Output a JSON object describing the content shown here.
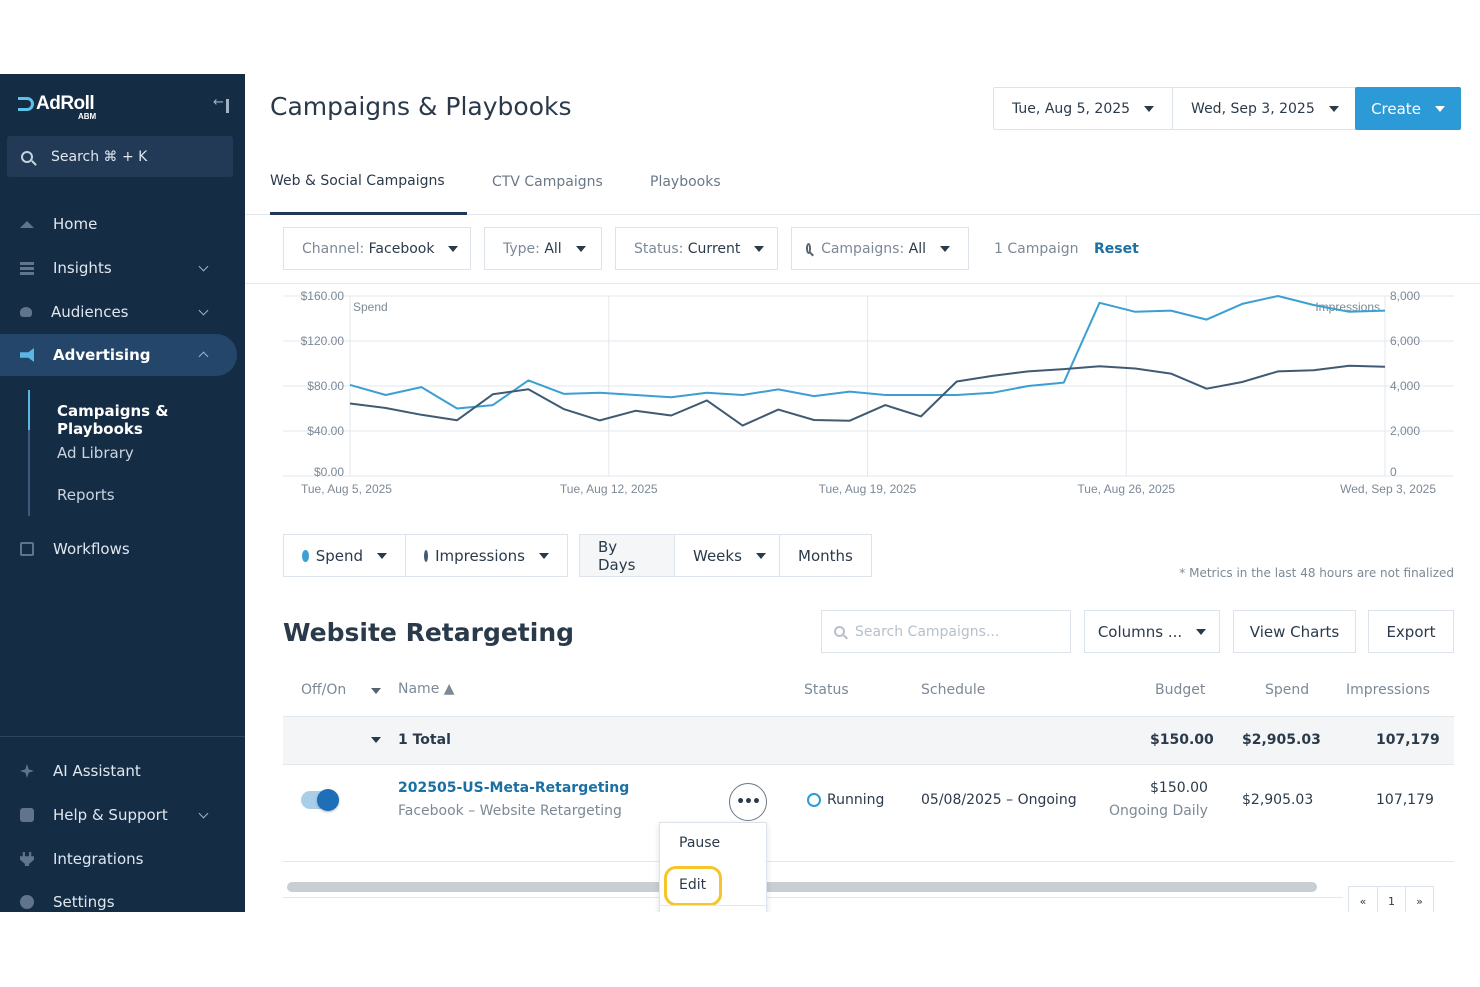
{
  "app": {
    "logo_text": "AdRoll",
    "logo_sub": "ABM"
  },
  "sidebar": {
    "search_label": "Search ⌘ + K",
    "items": [
      {
        "label": "Home",
        "icon": "home-icon"
      },
      {
        "label": "Insights",
        "icon": "bar-chart-icon"
      },
      {
        "label": "Audiences",
        "icon": "people-icon"
      },
      {
        "label": "Advertising",
        "icon": "megaphone-icon"
      },
      {
        "label": "Workflows",
        "icon": "workflow-icon"
      }
    ],
    "subitems": [
      "Campaigns & Playbooks",
      "Ad Library",
      "Reports"
    ],
    "bottom_items": [
      {
        "label": "AI Assistant",
        "icon": "sparkle-icon"
      },
      {
        "label": "Help & Support",
        "icon": "help-icon"
      },
      {
        "label": "Integrations",
        "icon": "plug-icon"
      },
      {
        "label": "Settings",
        "icon": "gear-icon"
      }
    ]
  },
  "header": {
    "title": "Campaigns & Playbooks",
    "start_date": "Tue, Aug 5, 2025",
    "end_date": "Wed, Sep 3, 2025",
    "create_label": "Create"
  },
  "tabs": [
    "Web & Social Campaigns",
    "CTV Campaigns",
    "Playbooks"
  ],
  "filters": {
    "channel_label": "Channel:",
    "channel_value": "Facebook",
    "type_label": "Type:",
    "type_value": "All",
    "status_label": "Status:",
    "status_value": "Current",
    "campaigns_label": "Campaigns:",
    "campaigns_value": "All",
    "count": "1 Campaign",
    "reset": "Reset"
  },
  "chart_data": {
    "type": "line",
    "x_tick_labels": [
      "Tue, Aug 5, 2025",
      "Tue, Aug 12, 2025",
      "Tue, Aug 19, 2025",
      "Tue, Aug 26, 2025",
      "Wed, Sep 3, 2025"
    ],
    "y_left_label": "Spend",
    "y_left_ticks": [
      "$160.00",
      "$120.00",
      "$80.00",
      "$40.00",
      "$0.00"
    ],
    "y_left_range": [
      0,
      160
    ],
    "y_right_label": "Impressions",
    "y_right_ticks": [
      "8,000",
      "6,000",
      "4,000",
      "2,000",
      "0"
    ],
    "y_right_range": [
      0,
      8000
    ],
    "grid": true,
    "series": [
      {
        "name": "Spend",
        "color": "#3c9fd2",
        "axis": "left",
        "values": [
          81,
          72,
          79,
          60,
          63,
          85,
          73,
          74,
          72,
          70,
          74,
          72,
          77,
          71,
          75,
          72,
          72,
          72,
          74,
          80,
          83,
          154,
          146,
          147,
          139,
          153,
          160,
          152,
          146,
          147
        ]
      },
      {
        "name": "Impressions",
        "color": "#3f5a72",
        "axis": "right",
        "values": [
          3220,
          3020,
          2720,
          2480,
          3630,
          3860,
          2970,
          2470,
          2900,
          2690,
          3360,
          2240,
          2950,
          2490,
          2460,
          3150,
          2650,
          4200,
          4450,
          4650,
          4750,
          4880,
          4780,
          4550,
          3880,
          4180,
          4650,
          4700,
          4900,
          4860
        ]
      }
    ]
  },
  "metrics": {
    "spend_label": "Spend",
    "impressions_label": "Impressions",
    "spend_color": "#3c9fd2",
    "impressions_color": "#3f5a72",
    "by_days": "By Days",
    "weeks": "Weeks",
    "months": "Months",
    "footnote": "* Metrics in the last 48 hours are not finalized"
  },
  "section": {
    "title": "Website Retargeting",
    "search_placeholder": "Search Campaigns...",
    "columns_label": "Columns ...",
    "view_charts_label": "View Charts",
    "export_label": "Export"
  },
  "table": {
    "headers": {
      "offon": "Off/On",
      "name": "Name ▲",
      "status": "Status",
      "schedule": "Schedule",
      "budget": "Budget",
      "spend": "Spend",
      "impressions": "Impressions"
    },
    "total": {
      "label": "1 Total",
      "budget": "$150.00",
      "spend": "$2,905.03",
      "impressions": "107,179"
    },
    "rows": [
      {
        "name": "202505-US-Meta-Retargeting",
        "subtitle": "Facebook – Website Retargeting",
        "status": "Running",
        "schedule": "05/08/2025 – Ongoing",
        "budget": "$150.00",
        "budget_sub": "Ongoing Daily",
        "spend": "$2,905.03",
        "impressions": "107,179"
      }
    ]
  },
  "row_menu": {
    "more_label": "•••",
    "items": [
      "Pause",
      "Edit"
    ]
  },
  "pager": {
    "prev": "«",
    "page": "1",
    "next": "»"
  }
}
